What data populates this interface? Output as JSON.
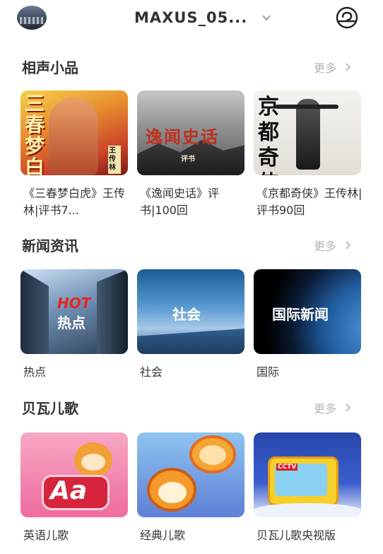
{
  "header": {
    "device_name": "MAXUS_05..."
  },
  "sections": [
    {
      "title": "相声小品",
      "more_label": "更多",
      "items": [
        {
          "caption": "《三春梦白虎》王传林|评书7...",
          "thumb_text": "三春梦白虎",
          "thumb_badge": "王传林"
        },
        {
          "caption": "《逸闻史话》评书|100回",
          "thumb_text": "逸闻史话",
          "thumb_badge": "评书"
        },
        {
          "caption": "《京都奇侠》王传林|评书90回",
          "thumb_text": "京都奇侠",
          "thumb_badge": ""
        }
      ]
    },
    {
      "title": "新闻资讯",
      "more_label": "更多",
      "items": [
        {
          "caption": "热点",
          "thumb_text": "热点",
          "thumb_badge": "HOT"
        },
        {
          "caption": "社会",
          "thumb_text": "社会",
          "thumb_badge": ""
        },
        {
          "caption": "国际",
          "thumb_text": "国际新闻",
          "thumb_badge": ""
        }
      ]
    },
    {
      "title": "贝瓦儿歌",
      "more_label": "更多",
      "items": [
        {
          "caption": "英语儿歌",
          "thumb_text": "Aa",
          "thumb_badge": ""
        },
        {
          "caption": "经典儿歌",
          "thumb_text": "",
          "thumb_badge": ""
        },
        {
          "caption": "贝瓦儿歌央视版",
          "thumb_text": "",
          "thumb_badge": "CCTV"
        }
      ]
    }
  ]
}
